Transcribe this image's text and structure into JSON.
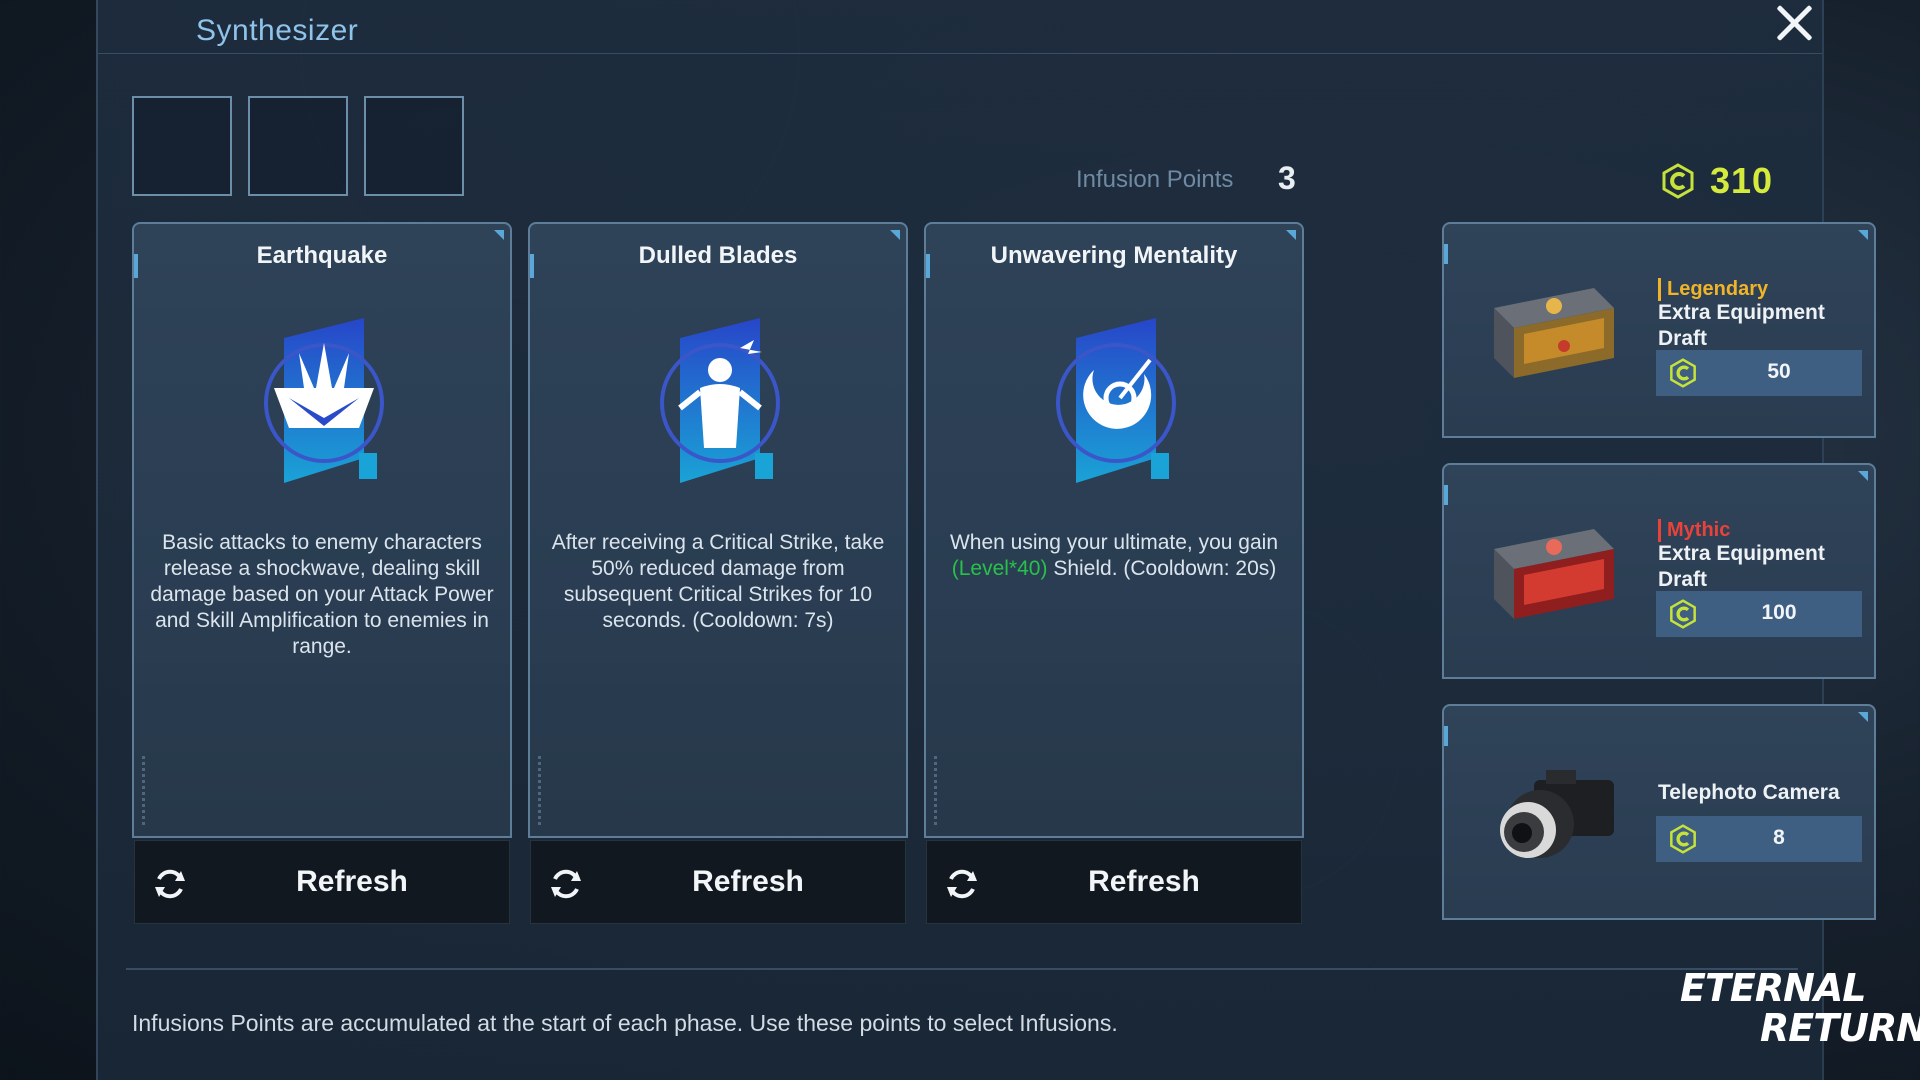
{
  "window": {
    "title": "Synthesizer",
    "close_icon": "close-icon"
  },
  "slots": [
    {},
    {},
    {}
  ],
  "infusion_points": {
    "label": "Infusion Points",
    "value": "3"
  },
  "currency": {
    "icon": "credit-icon",
    "amount": "310",
    "color": "#d4ea3c"
  },
  "cards": [
    {
      "title": "Earthquake",
      "icon": "earthquake-icon",
      "description": "Basic attacks to enemy characters release a shockwave, dealing skill damage based on your Attack Power and Skill Amplification to enemies in range.",
      "refresh_label": "Refresh"
    },
    {
      "title": "Dulled Blades",
      "icon": "dulled-blades-icon",
      "description": "After receiving a Critical Strike, take 50% reduced damage from subsequent Critical Strikes for 10 seconds. (Cooldown: 7s)",
      "refresh_label": "Refresh"
    },
    {
      "title": "Unwavering Mentality",
      "icon": "unwavering-mentality-icon",
      "description_pre": "When using your ultimate, you gain",
      "description_green": "(Level*40)",
      "description_post": "Shield. (Cooldown: 20s)",
      "refresh_label": "Refresh"
    }
  ],
  "shop": [
    {
      "rarity": "Legendary",
      "rarity_color": "#f0b429",
      "name": "Extra Equipment Draft",
      "price": "50",
      "icon": "legendary-chest-icon"
    },
    {
      "rarity": "Mythic",
      "rarity_color": "#e8423a",
      "name": "Extra Equipment Draft",
      "price": "100",
      "icon": "mythic-chest-icon"
    },
    {
      "rarity": "",
      "name": "Telephoto Camera",
      "price": "8",
      "icon": "camera-icon"
    }
  ],
  "footer": {
    "text": "Infusions Points are accumulated at the start of each phase. Use these points to select Infusions."
  },
  "logo": {
    "line1": "ETERNAL",
    "line2": "RETURN"
  }
}
